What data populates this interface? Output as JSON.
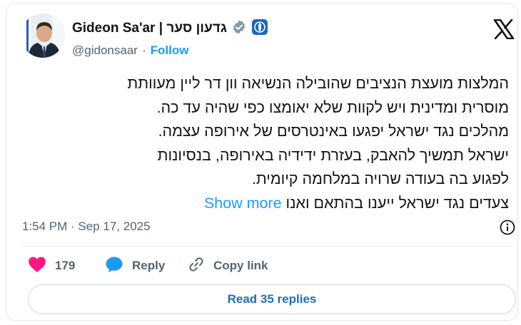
{
  "account": {
    "display_name": "Gideon Sa'ar | גדעון סער",
    "handle": "@gidonsaar",
    "separator": "·",
    "follow_label": "Follow",
    "verified_badge": "verified-badge-icon",
    "affiliate_badge": "israel-government-emblem-icon"
  },
  "tweet": {
    "lines": [
      "המלצות מועצת הנציבים שהובילה הנשיאה וון דר ליין מעוותת",
      "מוסרית ומדינית ויש לקוות שלא יאומצו כפי שהיה עד כה.",
      "מהלכים נגד ישראל יפגעו באינטרסים של אירופה עצמה.",
      "ישראל תמשיך להאבק, בעזרת ידידיה באירופה, בנסיונות",
      "לפגוע בה בעודה שרויה במלחמה קיומית.",
      "צעדים נגד ישראל ייענו בהתאם ואנו"
    ],
    "show_more_label": "Show more"
  },
  "meta": {
    "timestamp": "1:54 PM · Sep 17, 2025"
  },
  "actions": {
    "like_count": "179",
    "reply_label": "Reply",
    "copy_label": "Copy link"
  },
  "footer": {
    "read_replies_label": "Read 35 replies"
  },
  "colors": {
    "accent": "#1d9bf0",
    "like": "#f91880",
    "text": "#0f1419",
    "secondary": "#536471",
    "border": "#e1e8ed"
  }
}
